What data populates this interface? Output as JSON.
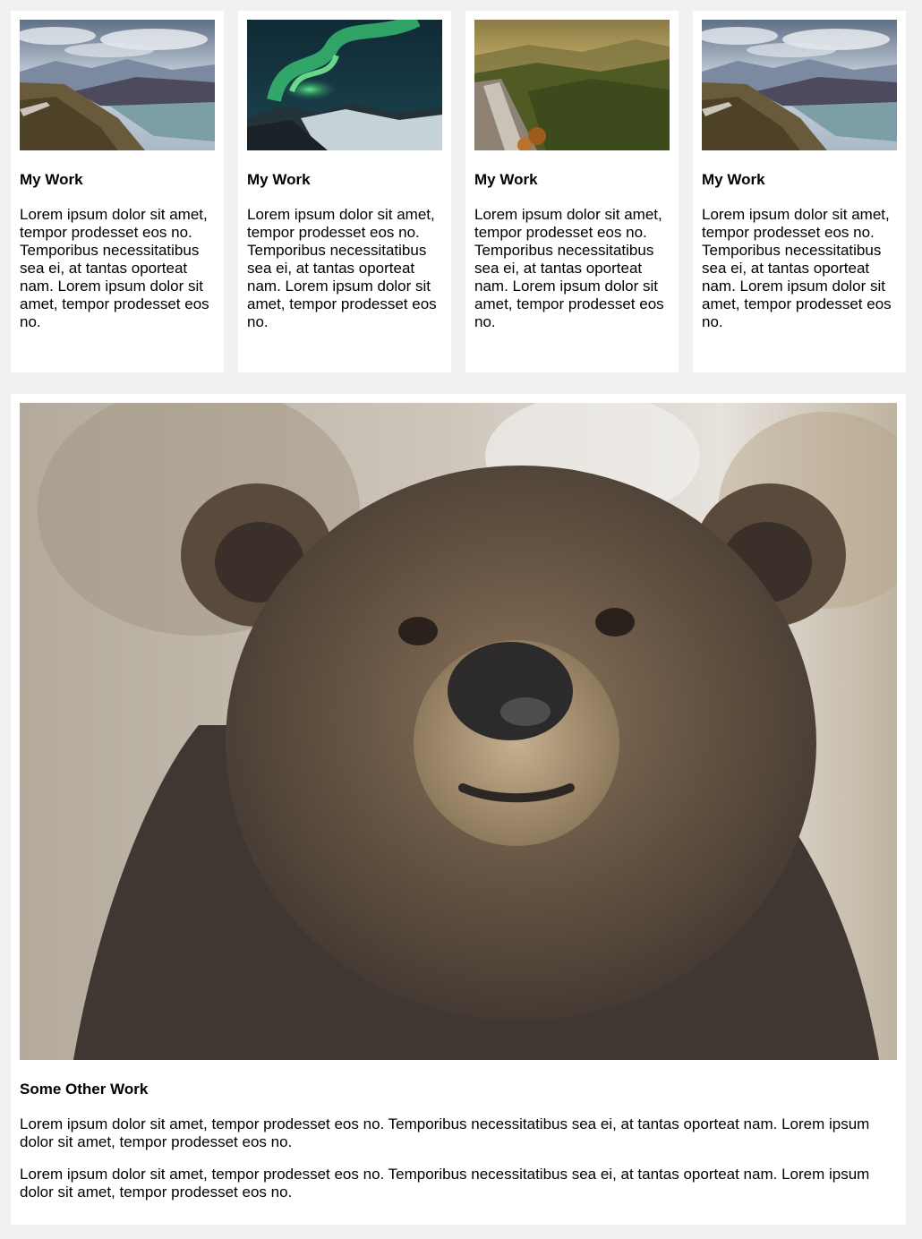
{
  "cards": [
    {
      "image": "mountain-lake-photo",
      "title": "My Work",
      "text": "Lorem ipsum dolor sit amet, tempor prodesset eos no. Temporibus necessitatibus sea ei, at tantas oporteat nam. Lorem ipsum dolor sit amet, tempor prodesset eos no."
    },
    {
      "image": "northern-lights-photo",
      "title": "My Work",
      "text": "Lorem ipsum dolor sit amet, tempor prodesset eos no. Temporibus necessitatibus sea ei, at tantas oporteat nam. Lorem ipsum dolor sit amet, tempor prodesset eos no."
    },
    {
      "image": "forest-valley-photo",
      "title": "My Work",
      "text": "Lorem ipsum dolor sit amet, tempor prodesset eos no. Temporibus necessitatibus sea ei, at tantas oporteat nam. Lorem ipsum dolor sit amet, tempor prodesset eos no."
    },
    {
      "image": "mountain-lake-photo",
      "title": "My Work",
      "text": "Lorem ipsum dolor sit amet, tempor prodesset eos no. Temporibus necessitatibus sea ei, at tantas oporteat nam. Lorem ipsum dolor sit amet, tempor prodesset eos no."
    }
  ],
  "feature": {
    "image": "bear-photo",
    "title": "Some Other Work",
    "paragraphs": [
      "Lorem ipsum dolor sit amet, tempor prodesset eos no. Temporibus necessitatibus sea ei, at tantas oporteat nam. Lorem ipsum dolor sit amet, tempor prodesset eos no.",
      "Lorem ipsum dolor sit amet, tempor prodesset eos no. Temporibus necessitatibus sea ei, at tantas oporteat nam. Lorem ipsum dolor sit amet, tempor prodesset eos no."
    ]
  },
  "colors": {
    "page_background": "#f1f1f1",
    "card_background": "#ffffff",
    "text": "#000000"
  }
}
